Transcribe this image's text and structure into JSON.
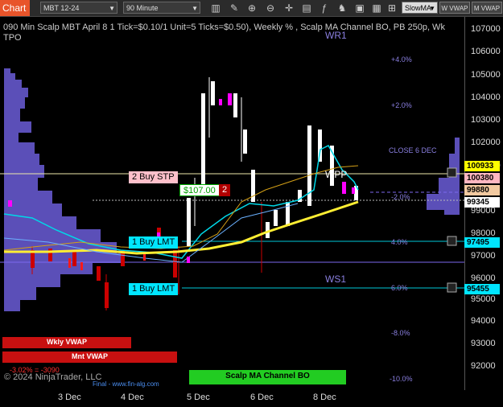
{
  "toolbar": {
    "chart_label": "Chart",
    "instrument": "MBT 12-24",
    "interval": "90 Minute",
    "indicator_select": "SlowMA",
    "btn_w_vwap": "W VWAP",
    "btn_m_vwap": "M VWAP"
  },
  "chart": {
    "title": "090 Min Scalp MBT April 8 1 Tick=$0.10/1 Unit=5 Ticks=$0.50), Weekly % , Scalp MA Channel BO, PB 250p, Wk TPO",
    "copyright": "© 2024 NinjaTrader, LLC",
    "final_link": "Final - www.fin-alg.com",
    "wr1": "WR1",
    "ws1": "WS1",
    "wpp": "WPP",
    "close_label": "CLOSE 6 DEC",
    "pct_labels": [
      "+4.0%",
      "+2.0%",
      "-2.0%",
      "4.0%",
      "6.0%",
      "-8.0%",
      "-10.0%"
    ],
    "red_pct": "-3.02% = -3090",
    "buy_stp": "2 Buy STP",
    "pnl": "$107.00",
    "pnl_qty": "2",
    "buy_lmt1": "1 Buy LMT",
    "buy_lmt2": "1 Buy LMT",
    "wkly_vwap": "Wkly VWAP",
    "mnt_vwap": "Mnt VWAP",
    "channel_bo": "Scalp MA Channel BO"
  },
  "price_tags": [
    {
      "value": "100933",
      "color": "#ffff00"
    },
    {
      "value": "100380",
      "color": "#ffb6c1"
    },
    {
      "value": "99880",
      "color": "#f2c9a0"
    },
    {
      "value": "99345",
      "color": "#ffffff"
    },
    {
      "value": "97495",
      "color": "#00e5ff"
    },
    {
      "value": "95455",
      "color": "#00e5ff"
    }
  ],
  "y_ticks": [
    "107000",
    "106000",
    "105000",
    "104000",
    "103000",
    "102000",
    "101000",
    "99000",
    "98000",
    "97000",
    "96000",
    "95000",
    "94000",
    "93000",
    "92000"
  ],
  "x_ticks": [
    "3 Dec",
    "4 Dec",
    "5 Dec",
    "6 Dec",
    "8 Dec"
  ],
  "colors": {
    "accent": "#e8542a",
    "profile": "#6a5acd",
    "cyan": "#00e5ff",
    "yellow": "#ffee33"
  }
}
